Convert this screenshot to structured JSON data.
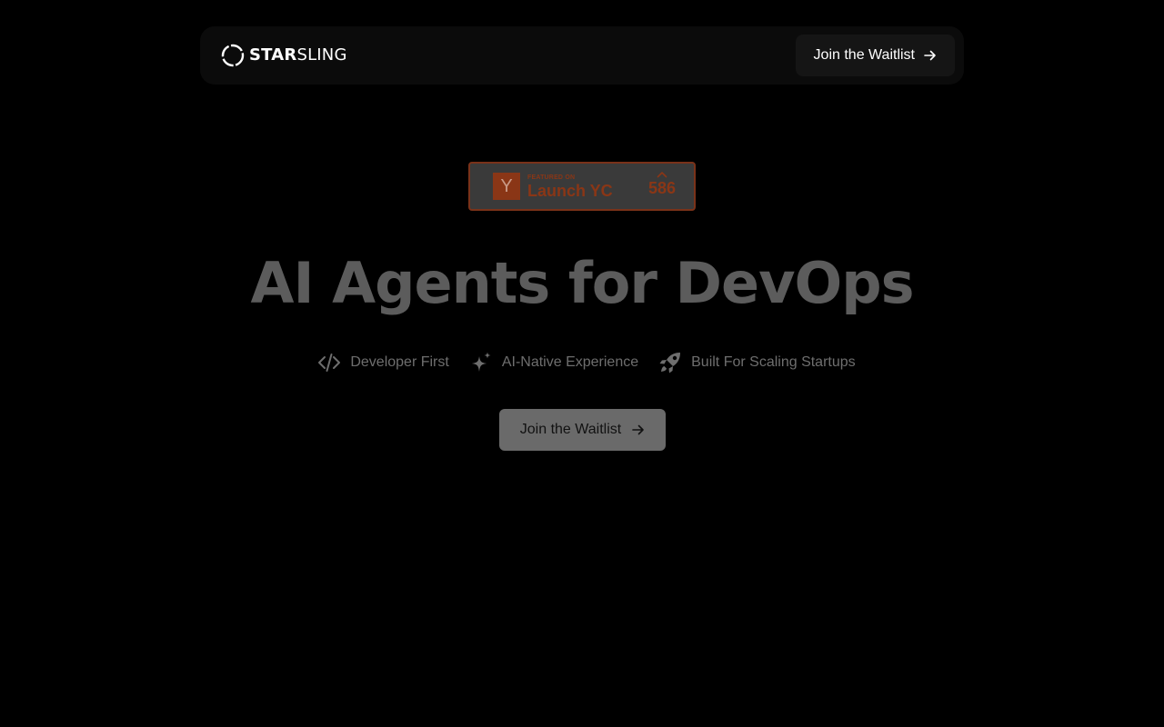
{
  "brand": {
    "name_bold": "STAR",
    "name_light": "SLING",
    "logo_icon": "starsling-ring-logo"
  },
  "nav": {
    "cta_label": "Join the Waitlist",
    "cta_icon": "arrow-right-icon"
  },
  "yc_badge": {
    "logo_letter": "Y",
    "featured_label": "FEATURED ON",
    "title": "Launch YC",
    "upvote_icon": "caret-up-icon",
    "count": "586",
    "accent_color": "#8a3616"
  },
  "hero": {
    "headline": "AI Agents for DevOps",
    "features": [
      {
        "icon": "code-icon",
        "label": "Developer First"
      },
      {
        "icon": "sparkle-icon",
        "label": "AI-Native Experience"
      },
      {
        "icon": "rocket-icon",
        "label": "Built For Scaling Startups"
      }
    ],
    "cta_label": "Join the Waitlist",
    "cta_icon": "arrow-right-icon"
  },
  "colors": {
    "background": "#000000",
    "navbar": "#0b0b0b",
    "headline": "#5c5c5c",
    "cta_background": "#6a6a6a"
  }
}
